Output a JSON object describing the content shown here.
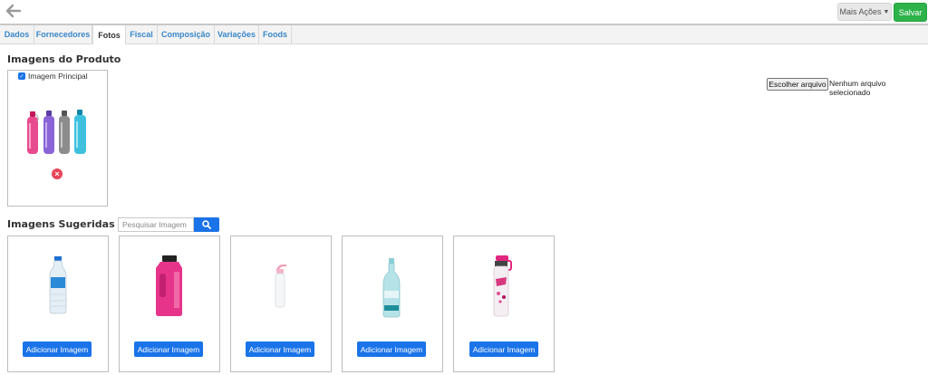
{
  "toolbar": {
    "more_actions_label": "Mais Ações",
    "save_label": "Salvar"
  },
  "tabs": [
    {
      "label": "Dados"
    },
    {
      "label": "Fornecedores"
    },
    {
      "label": "Fotos",
      "active": true
    },
    {
      "label": "Fiscal"
    },
    {
      "label": "Composição"
    },
    {
      "label": "Variações"
    },
    {
      "label": "Foods"
    }
  ],
  "product_images": {
    "title": "Imagens do Produto",
    "main_checkbox_label": "Imagem Principal",
    "main_checked": true,
    "file_button_label": "Escolher arquivo",
    "file_status": "Nenhum arquivo selecionado"
  },
  "suggested": {
    "title": "Imagens Sugeridas",
    "search_placeholder": "Pesquisar Imagem",
    "add_label": "Adicionar Imagem"
  },
  "colors": {
    "primary": "#1a73e8",
    "save": "#2db34a",
    "tab_text": "#3a87c8",
    "remove": "#e8455a"
  }
}
